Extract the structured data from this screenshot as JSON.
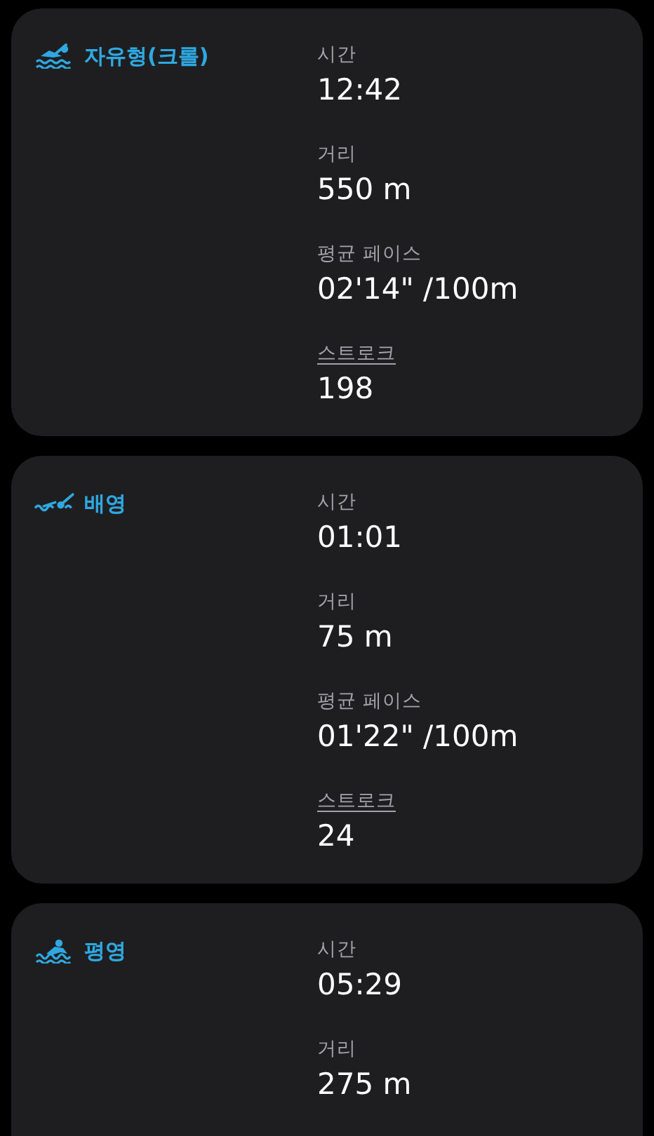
{
  "laps": [
    {
      "kind": "freestyle",
      "title": "자유형(크롤)",
      "stats": [
        {
          "kind": "plain",
          "label": "시간",
          "value": "12:42"
        },
        {
          "kind": "plain",
          "label": "거리",
          "value": "550 m"
        },
        {
          "kind": "plain",
          "label": "평균 페이스",
          "value": "02'14\" /100m"
        },
        {
          "kind": "link",
          "label": "스트로크",
          "value": "198"
        }
      ]
    },
    {
      "kind": "backstroke",
      "title": "배영",
      "stats": [
        {
          "kind": "plain",
          "label": "시간",
          "value": "01:01"
        },
        {
          "kind": "plain",
          "label": "거리",
          "value": "75 m"
        },
        {
          "kind": "plain",
          "label": "평균 페이스",
          "value": "01'22\" /100m"
        },
        {
          "kind": "link",
          "label": "스트로크",
          "value": "24"
        }
      ]
    },
    {
      "kind": "breaststroke",
      "title": "평영",
      "stats": [
        {
          "kind": "plain",
          "label": "시간",
          "value": "05:29"
        },
        {
          "kind": "plain",
          "label": "거리",
          "value": "275 m"
        }
      ]
    }
  ]
}
